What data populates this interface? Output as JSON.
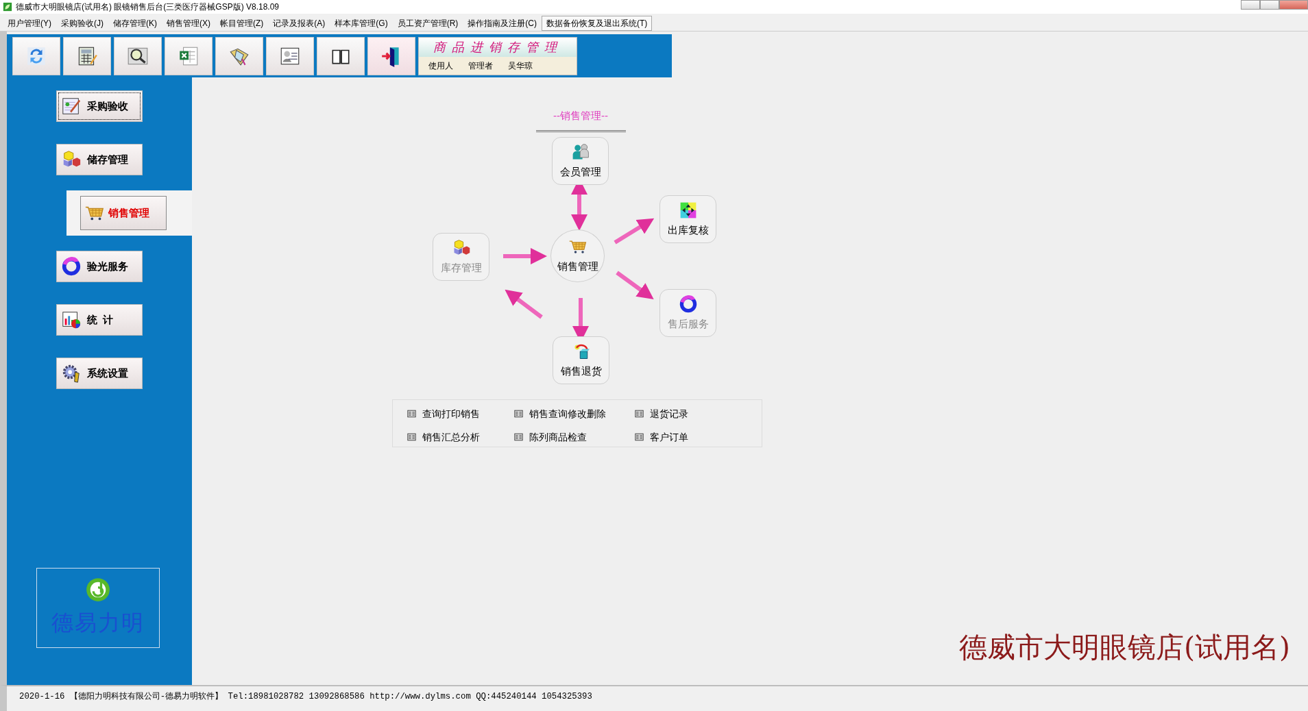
{
  "window": {
    "title": "德威市大明眼镜店(试用名) 眼镜销售后台(三类医疗器械GSP版) V8.18.09"
  },
  "menu": [
    {
      "label": "用户管理(Y)",
      "highlighted": false
    },
    {
      "label": "采购验收(J)",
      "highlighted": false
    },
    {
      "label": "储存管理(K)",
      "highlighted": false
    },
    {
      "label": "销售管理(X)",
      "highlighted": false
    },
    {
      "label": "帐目管理(Z)",
      "highlighted": false
    },
    {
      "label": "记录及报表(A)",
      "highlighted": false
    },
    {
      "label": "样本库管理(G)",
      "highlighted": false
    },
    {
      "label": "员工资产管理(R)",
      "highlighted": false
    },
    {
      "label": "操作指南及注册(C)",
      "highlighted": false
    },
    {
      "label": "数据备份恢复及退出系统(T)",
      "highlighted": true
    }
  ],
  "banner": {
    "title": "商品进销存管理",
    "user_label": "使用人",
    "role": "管理者",
    "user": "吴华琼"
  },
  "sidebar": {
    "items": [
      {
        "label": "采购验收",
        "selected": false,
        "focused": true
      },
      {
        "label": "储存管理",
        "selected": false,
        "focused": false
      },
      {
        "label": "销售管理",
        "selected": true,
        "focused": false
      },
      {
        "label": "验光服务",
        "selected": false,
        "focused": false
      },
      {
        "label": "统  计",
        "selected": false,
        "focused": false
      },
      {
        "label": "系统设置",
        "selected": false,
        "focused": false
      }
    ]
  },
  "logo": {
    "text": "德易力明"
  },
  "diagram": {
    "title": "--销售管理--",
    "nodes": [
      {
        "label": "会员管理",
        "kind": "box",
        "disabled": false
      },
      {
        "label": "出库复核",
        "kind": "box",
        "disabled": false
      },
      {
        "label": "库存管理",
        "kind": "box",
        "disabled": true
      },
      {
        "label": "销售管理",
        "kind": "circle",
        "disabled": false
      },
      {
        "label": "售后服务",
        "kind": "box",
        "disabled": true
      },
      {
        "label": "销售退货",
        "kind": "box",
        "disabled": false
      }
    ],
    "links": [
      "查询打印销售",
      "销售查询修改删除",
      "退货记录",
      "销售汇总分析",
      "陈列商品检查",
      "客户订单"
    ]
  },
  "store_name": "德威市大明眼镜店(试用名)",
  "status_bar": "2020-1-16 【德阳力明科技有限公司-德易力明软件】 Tel:18981028782 13092868586 http://www.dylms.com QQ:445240144 1054325393"
}
